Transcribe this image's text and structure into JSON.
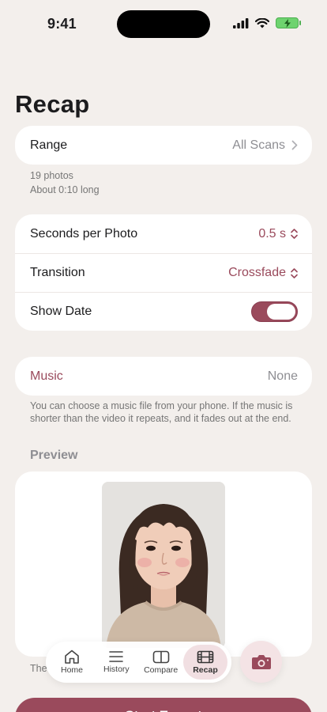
{
  "status": {
    "time": "9:41"
  },
  "page": {
    "title": "Recap"
  },
  "range": {
    "label": "Range",
    "value": "All Scans"
  },
  "range_info": {
    "photos": "19 photos",
    "length": "About 0:10 long"
  },
  "settings": {
    "seconds_label": "Seconds per Photo",
    "seconds_value": "0.5 s",
    "transition_label": "Transition",
    "transition_value": "Crossfade",
    "show_date_label": "Show Date",
    "show_date_on": true
  },
  "music": {
    "label": "Music",
    "value": "None",
    "note": "You can choose a music file from your phone. If the music is shorter than the video it repeats, and it fades out at the end."
  },
  "preview": {
    "header": "Preview",
    "partial_note": "The"
  },
  "tabbar": {
    "tabs": [
      {
        "label": "Home",
        "icon": "house-icon"
      },
      {
        "label": "History",
        "icon": "list-icon"
      },
      {
        "label": "Compare",
        "icon": "compare-icon"
      },
      {
        "label": "Recap",
        "icon": "film-icon",
        "active": true
      }
    ]
  },
  "camera": {
    "icon": "camera-icon"
  },
  "export": {
    "label": "Start Export"
  },
  "colors": {
    "accent": "#9a4a5c",
    "background": "#f3efec",
    "card": "#ffffff"
  }
}
